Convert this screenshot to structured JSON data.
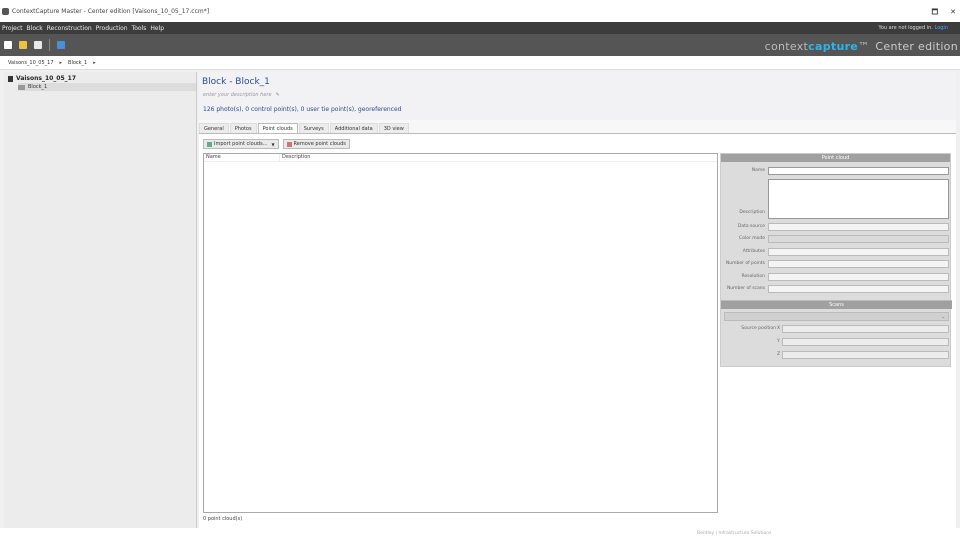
{
  "window": {
    "title": "ContextCapture Master - Center edition [Vaisons_10_05_17.ccm*]",
    "controls": [
      "🗖",
      "✕"
    ]
  },
  "menu": {
    "items": [
      "Project",
      "Block",
      "Reconstruction",
      "Production",
      "Tools",
      "Help"
    ],
    "login_text": "You are not logged in.",
    "login_link": "Login"
  },
  "toolbar": {
    "buttons": [
      {
        "name": "new-project",
        "color": "#ffffff"
      },
      {
        "name": "open-project",
        "color": "#f0c040"
      },
      {
        "name": "save-project",
        "color": "#e8e8e8"
      }
    ],
    "icon_accent": "#4a90d9"
  },
  "brand": {
    "prefix": "context",
    "capture": "capture",
    "tm": "™",
    "edition": "Center edition"
  },
  "breadcrumb": {
    "items": [
      "Vaisons_10_05_17",
      "Block_1"
    ]
  },
  "tree": {
    "root": "Vaisons_10_05_17",
    "children": [
      "Block_1"
    ]
  },
  "block": {
    "title": "Block - Block_1",
    "description_placeholder": "enter your description here",
    "summary": "126 photo(s), 0 control point(s), 0 user tie point(s), georeferenced",
    "tabs": [
      "General",
      "Photos",
      "Point clouds",
      "Surveys",
      "Additional data",
      "3D view"
    ],
    "active_tab": "Point clouds"
  },
  "pointclouds": {
    "import_label": "Import point clouds...",
    "remove_label": "Remove point clouds",
    "columns": [
      "Name",
      "Description"
    ],
    "status": "0 point cloud(s)"
  },
  "panel": {
    "header": "Point cloud",
    "fields": {
      "name": "Name",
      "description": "Description",
      "data_source": "Data source",
      "color_mode": "Color mode",
      "attributes": "Attributes",
      "number_of_points": "Number of points",
      "resolution": "Resolution",
      "number_of_scans": "Number of scans"
    },
    "scans_header": "Scans",
    "scan_fields": {
      "source_position": "Source position",
      "x": "X",
      "y": "Y",
      "z": "Z"
    }
  },
  "footer": {
    "text": "Bentley | Infrastructure Solutions"
  }
}
